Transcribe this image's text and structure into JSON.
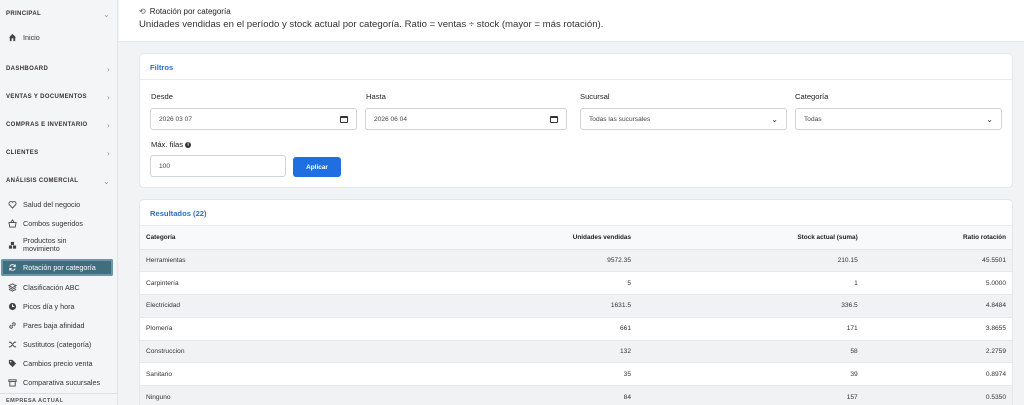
{
  "sidebar": {
    "sections": {
      "principal": "PRINCIPAL",
      "dashboard": "DASHBOARD",
      "ventas": "VENTAS Y DOCUMENTOS",
      "compras": "COMPRAS E INVENTARIO",
      "clientes": "CLIENTES",
      "analisis": "ANÁLISIS COMERCIAL"
    },
    "inicio": "Inicio",
    "items": [
      {
        "label": "Salud del negocio",
        "icon": "heart-icon"
      },
      {
        "label": "Combos sugeridos",
        "icon": "basket-icon"
      },
      {
        "label": "Productos sin movimiento",
        "icon": "boxes-icon"
      },
      {
        "label": "Rotación por categoría",
        "icon": "refresh-icon"
      },
      {
        "label": "Clasificación ABC",
        "icon": "layers-icon"
      },
      {
        "label": "Picos día y hora",
        "icon": "clock-icon"
      },
      {
        "label": "Pares baja afinidad",
        "icon": "link-icon"
      },
      {
        "label": "Sustitutos (categoría)",
        "icon": "shuffle-icon"
      },
      {
        "label": "Cambios precio venta",
        "icon": "tag-icon"
      },
      {
        "label": "Comparativa sucursales",
        "icon": "store-icon"
      }
    ],
    "footer": "EMPRESA ACTUAL"
  },
  "header": {
    "title": "Rotación por categoría",
    "subtitle": "Unidades vendidas en el período y stock actual por categoría. Ratio = ventas ÷ stock (mayor = más rotación)."
  },
  "filters": {
    "title": "Filtros",
    "desde_label": "Desde",
    "desde_value": "2026 03 07",
    "hasta_label": "Hasta",
    "hasta_value": "2026 06 04",
    "sucursal_label": "Sucursal",
    "sucursal_value": "Todas las sucursales",
    "categoria_label": "Categoría",
    "categoria_value": "Todas",
    "max_label": "Máx. filas",
    "max_value": "100",
    "apply": "Aplicar"
  },
  "results": {
    "title": "Resultados (22)",
    "columns": [
      "Categoría",
      "Unidades vendidas",
      "Stock actual (suma)",
      "Ratio rotación"
    ],
    "rows": [
      [
        "Herramientas",
        "9572.35",
        "210.15",
        "45.5501"
      ],
      [
        "Carpintería",
        "5",
        "1",
        "5.0000"
      ],
      [
        "Electricidad",
        "1631.5",
        "336.5",
        "4.8484"
      ],
      [
        "Plomería",
        "661",
        "171",
        "3.8655"
      ],
      [
        "Construccion",
        "132",
        "58",
        "2.2759"
      ],
      [
        "Sanitario",
        "35",
        "39",
        "0.8974"
      ],
      [
        "Ninguno",
        "84",
        "157",
        "0.5350"
      ]
    ]
  }
}
